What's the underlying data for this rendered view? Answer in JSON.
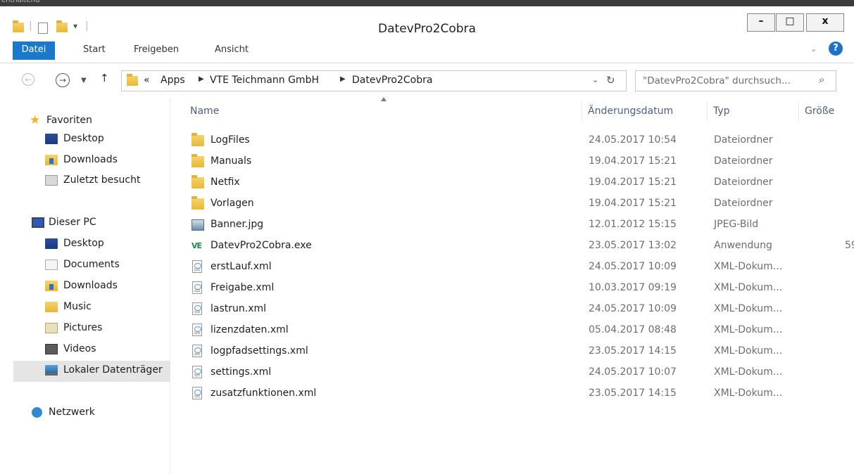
{
  "window": {
    "title": "DatevPro2Cobra",
    "top_strip_text": "enthaltend"
  },
  "controls": {
    "minimize": "–",
    "maximize": "□",
    "close": "x"
  },
  "ribbon": {
    "tabs": [
      "Datei",
      "Start",
      "Freigeben",
      "Ansicht"
    ]
  },
  "address": {
    "overflow": "«",
    "crumbs": [
      "Apps",
      "VTE Teichmann GmbH",
      "DatevPro2Cobra"
    ],
    "search_placeholder": "\"DatevPro2Cobra\" durchsuch..."
  },
  "columns": {
    "name": "Name",
    "date": "Änderungsdatum",
    "type": "Typ",
    "size": "Größe"
  },
  "nav": {
    "favorites": "Favoriten",
    "fav_items": [
      "Desktop",
      "Downloads",
      "Zuletzt besucht"
    ],
    "pc": "Dieser PC",
    "pc_items": [
      "Desktop",
      "Documents",
      "Downloads",
      "Music",
      "Pictures",
      "Videos",
      "Lokaler Datenträger"
    ],
    "network": "Netzwerk"
  },
  "files": [
    {
      "name": "LogFiles",
      "date": "24.05.2017 10:54",
      "type": "Dateiordner",
      "size": "",
      "icon": "folder-icon"
    },
    {
      "name": "Manuals",
      "date": "19.04.2017 15:21",
      "type": "Dateiordner",
      "size": "",
      "icon": "folder-icon"
    },
    {
      "name": "Netfix",
      "date": "19.04.2017 15:21",
      "type": "Dateiordner",
      "size": "",
      "icon": "folder-icon"
    },
    {
      "name": "Vorlagen",
      "date": "19.04.2017 15:21",
      "type": "Dateiordner",
      "size": "",
      "icon": "folder-icon"
    },
    {
      "name": "Banner.jpg",
      "date": "12.01.2012 15:15",
      "type": "JPEG-Bild",
      "size": "",
      "icon": "image-icon"
    },
    {
      "name": "DatevPro2Cobra.exe",
      "date": "23.05.2017 13:02",
      "type": "Anwendung",
      "size": "59",
      "icon": "app-icon"
    },
    {
      "name": "erstLauf.xml",
      "date": "24.05.2017 10:09",
      "type": "XML-Dokum...",
      "size": "",
      "icon": "xml-file-icon"
    },
    {
      "name": "Freigabe.xml",
      "date": "10.03.2017 09:19",
      "type": "XML-Dokum...",
      "size": "",
      "icon": "xml-file-icon"
    },
    {
      "name": "lastrun.xml",
      "date": "24.05.2017 10:09",
      "type": "XML-Dokum...",
      "size": "",
      "icon": "xml-file-icon"
    },
    {
      "name": "lizenzdaten.xml",
      "date": "05.04.2017 08:48",
      "type": "XML-Dokum...",
      "size": "",
      "icon": "xml-file-icon"
    },
    {
      "name": "logpfadsettings.xml",
      "date": "23.05.2017 14:15",
      "type": "XML-Dokum...",
      "size": "",
      "icon": "xml-file-icon"
    },
    {
      "name": "settings.xml",
      "date": "24.05.2017 10:07",
      "type": "XML-Dokum...",
      "size": "",
      "icon": "xml-file-icon"
    },
    {
      "name": "zusatzfunktionen.xml",
      "date": "23.05.2017 14:15",
      "type": "XML-Dokum...",
      "size": "",
      "icon": "xml-file-icon"
    }
  ],
  "colors": {
    "accent": "#1979ca",
    "header_text": "#4d6082",
    "selection": "#e5e5e5"
  }
}
